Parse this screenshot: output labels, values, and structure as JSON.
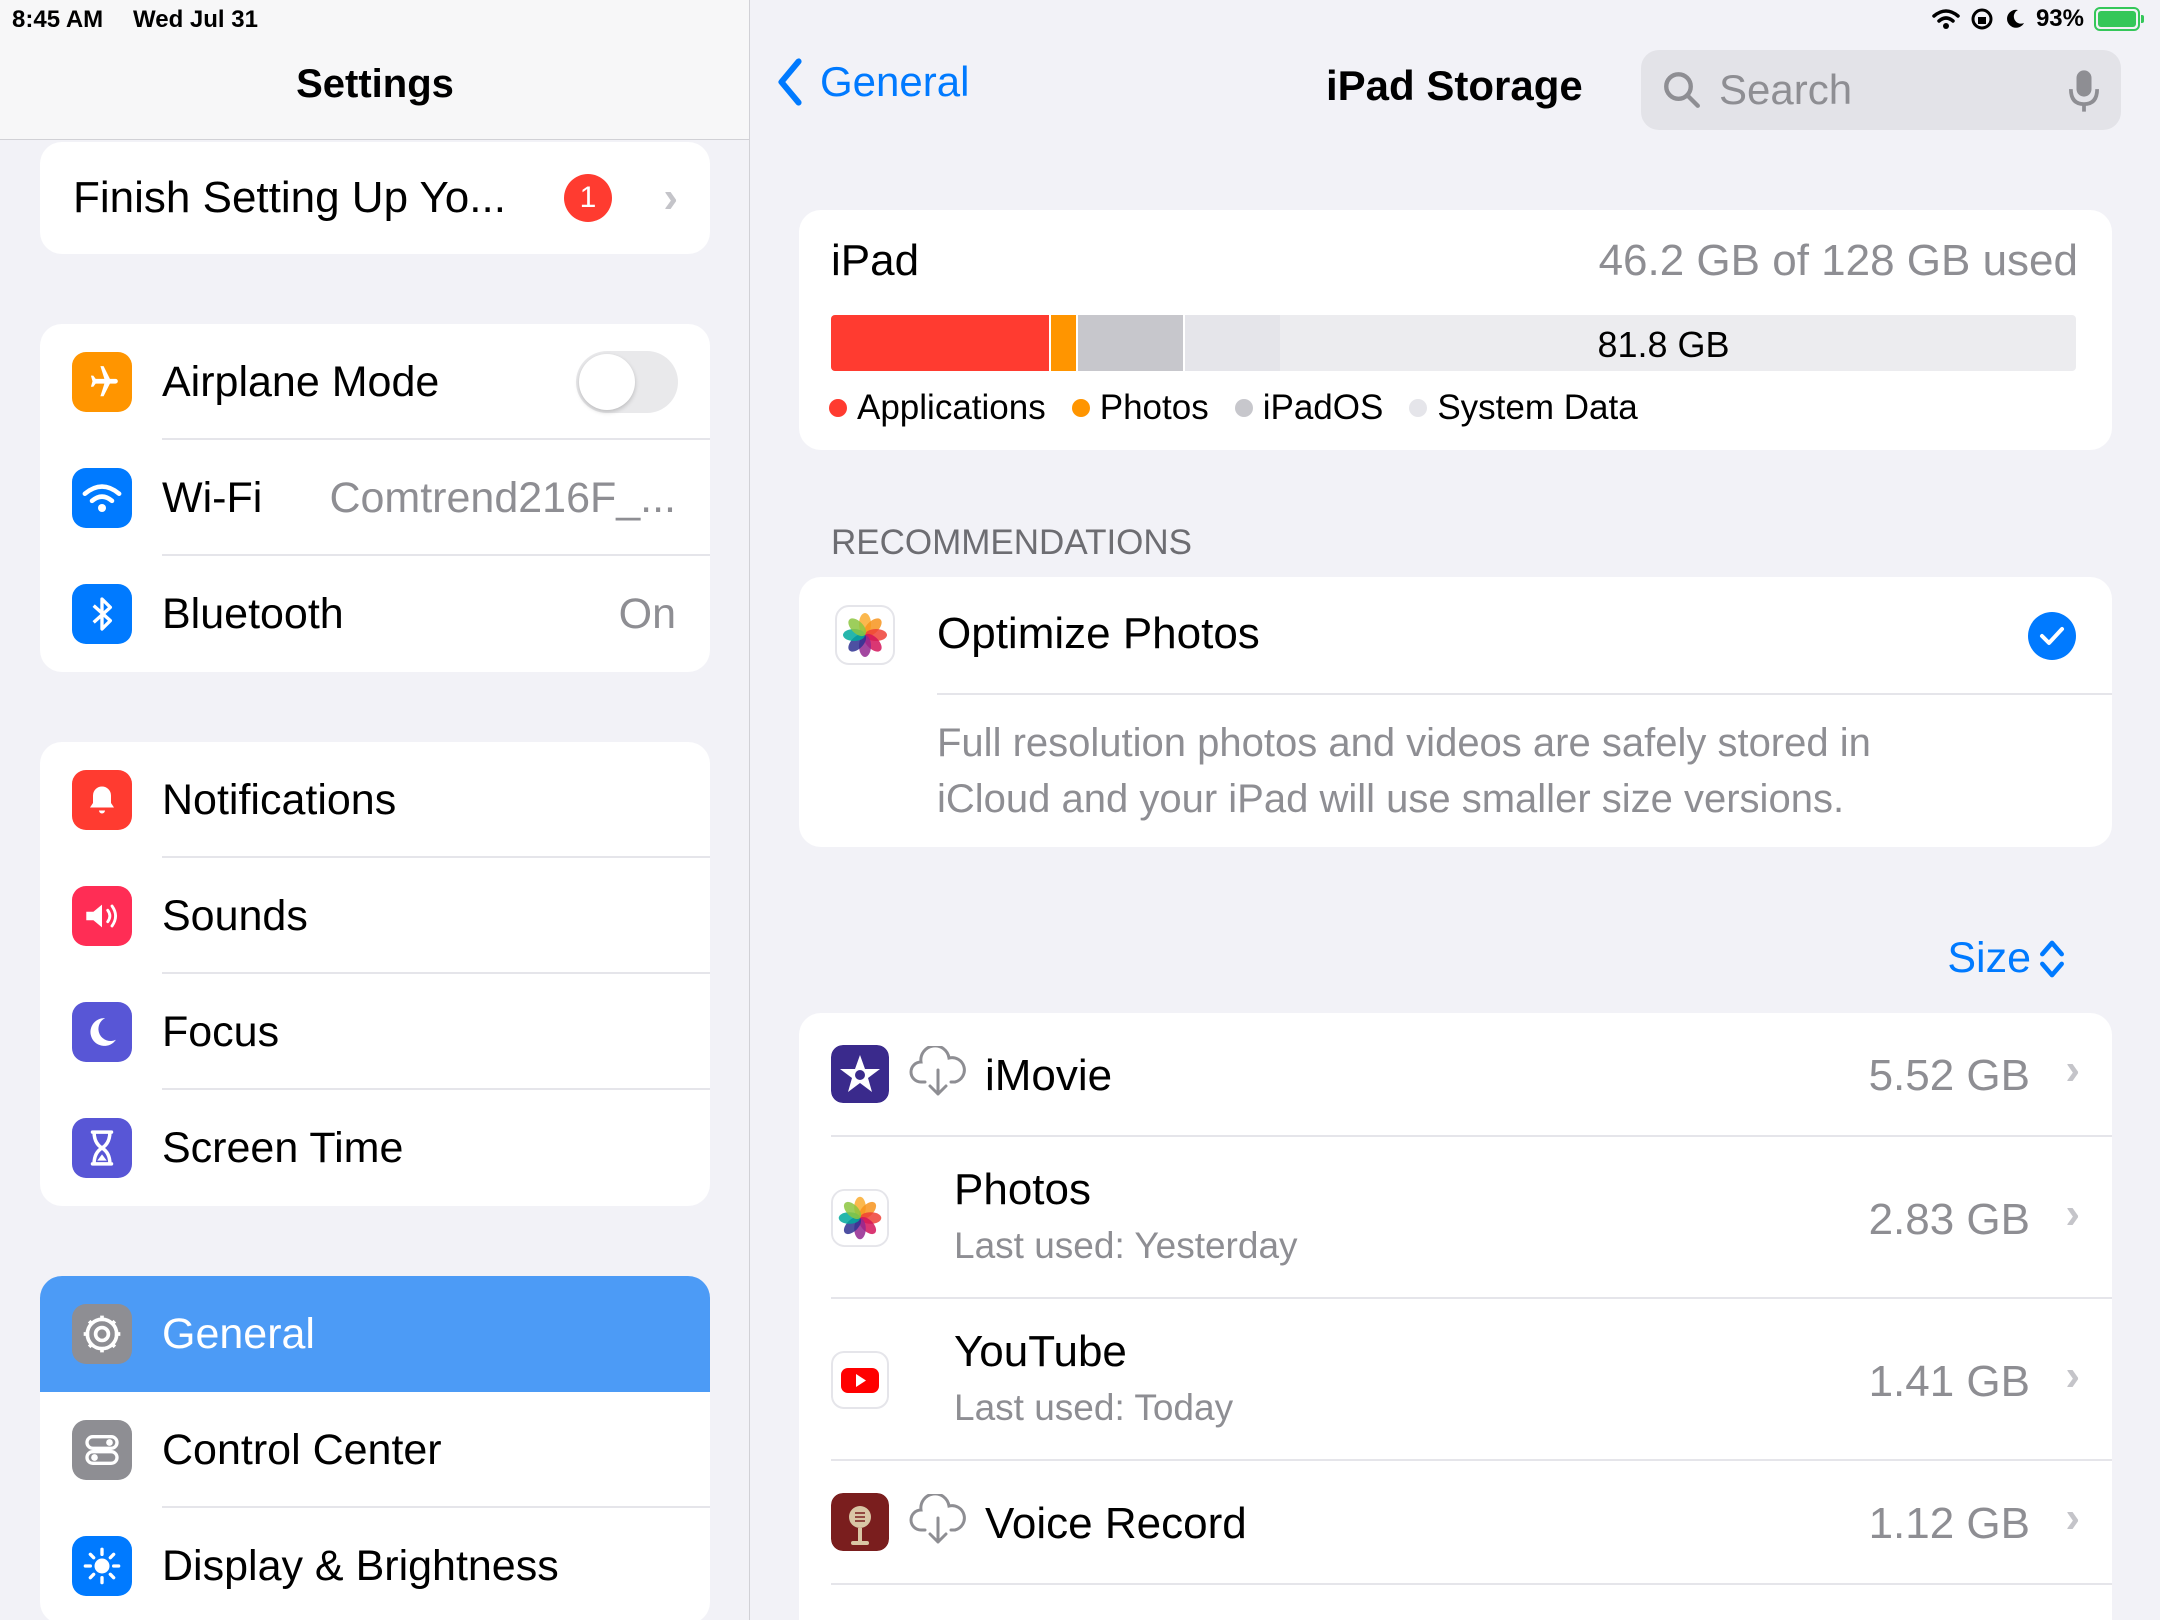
{
  "status": {
    "time": "8:45 AM",
    "date": "Wed Jul 31",
    "battery": "93%"
  },
  "sidebar": {
    "title": "Settings",
    "finish_setup": {
      "label": "Finish Setting Up Yo...",
      "badge": "1"
    },
    "connectivity": [
      {
        "label": "Airplane Mode",
        "icon": "airplane-icon",
        "color": "#ff9500"
      },
      {
        "label": "Wi-Fi",
        "value": "Comtrend216F_...",
        "icon": "wifi-icon",
        "color": "#007aff"
      },
      {
        "label": "Bluetooth",
        "value": "On",
        "icon": "bluetooth-icon",
        "color": "#007aff"
      }
    ],
    "alerts": [
      {
        "label": "Notifications",
        "icon": "bell-icon",
        "color": "#ff3b30"
      },
      {
        "label": "Sounds",
        "icon": "speaker-icon",
        "color": "#ff2d55"
      },
      {
        "label": "Focus",
        "icon": "moon-icon",
        "color": "#5856d6"
      },
      {
        "label": "Screen Time",
        "icon": "hourglass-icon",
        "color": "#5856d6"
      }
    ],
    "system": [
      {
        "label": "General",
        "icon": "gear-icon",
        "color": "#8e8e93",
        "selected": true
      },
      {
        "label": "Control Center",
        "icon": "switches-icon",
        "color": "#8e8e93"
      },
      {
        "label": "Display & Brightness",
        "icon": "sun-icon",
        "color": "#007aff"
      }
    ]
  },
  "nav": {
    "back_label": "General",
    "title": "iPad Storage",
    "search_placeholder": "Search"
  },
  "storage": {
    "device": "iPad",
    "used_label": "46.2 GB of 128 GB used",
    "free_label": "81.8 GB",
    "segments": [
      {
        "name": "Applications",
        "color": "#ff3b30",
        "gb": 22.4
      },
      {
        "name": "Photos",
        "color": "#ff9500",
        "gb": 2.83
      },
      {
        "name": "iPadOS",
        "color": "#c7c7cc",
        "gb": 11.0
      },
      {
        "name": "System Data",
        "color": "#e5e5ea",
        "gb": 9.97
      }
    ],
    "total_gb": 128
  },
  "recommendations": {
    "section_label": "RECOMMENDATIONS",
    "title": "Optimize Photos",
    "description_line1": "Full resolution photos and videos are safely stored in",
    "description_line2": "iCloud and your iPad will use smaller size versions."
  },
  "sort_label": "Size",
  "apps": [
    {
      "name": "iMovie",
      "size": "5.52 GB",
      "icon": "imovie-icon",
      "cloud": true
    },
    {
      "name": "Photos",
      "sub": "Last used: Yesterday",
      "size": "2.83 GB",
      "icon": "photos-icon"
    },
    {
      "name": "YouTube",
      "sub": "Last used: Today",
      "size": "1.41 GB",
      "icon": "youtube-icon"
    },
    {
      "name": "Voice Record",
      "size": "1.12 GB",
      "icon": "voice-record-icon",
      "cloud": true
    }
  ]
}
